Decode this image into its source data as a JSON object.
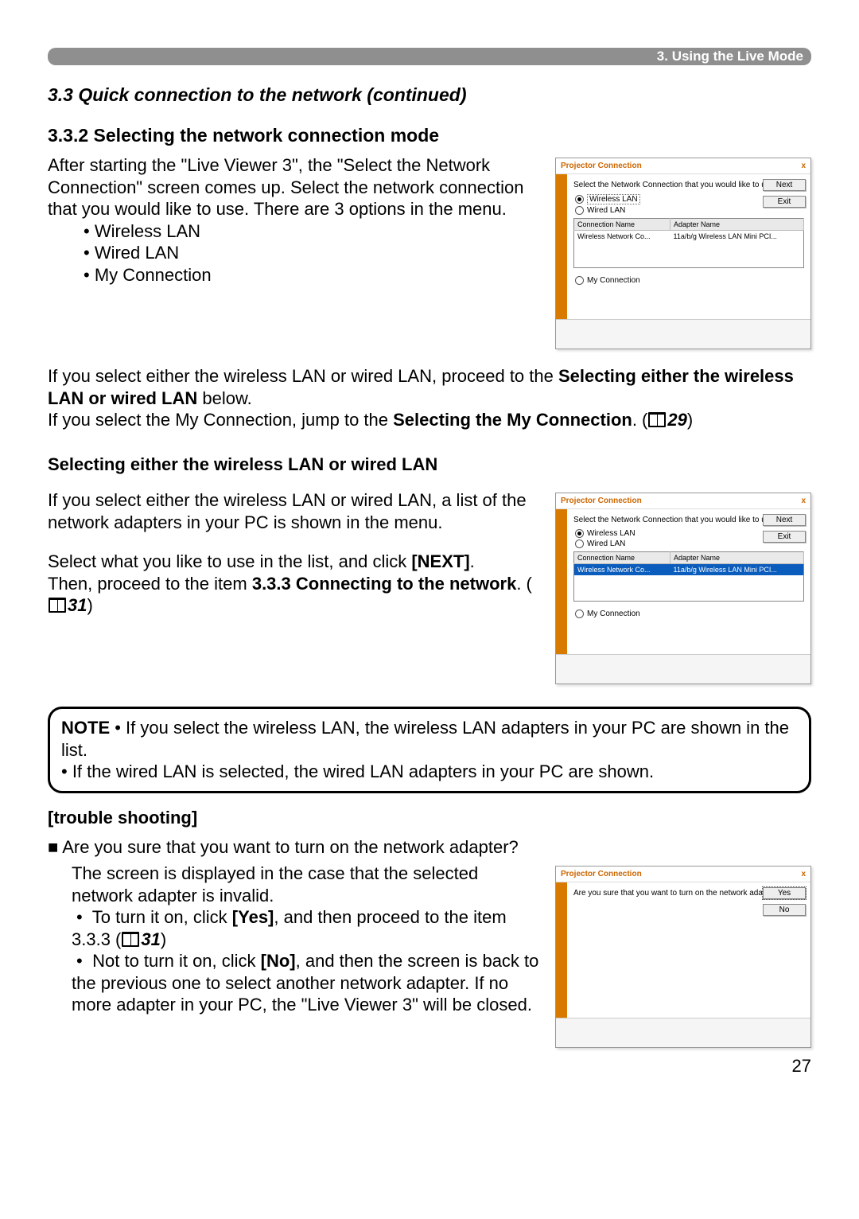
{
  "header": {
    "title": "3. Using the Live Mode"
  },
  "sec_cont": "3.3 Quick connection to the network (continued)",
  "subsec": "3.3.2 Selecting the network connection mode",
  "intro": {
    "p": "After starting the \"Live Viewer 3\", the \"Select the Network Connection\" screen comes up. Select the network connection that you would like to use. There are 3 options in the menu.",
    "options": [
      "Wireless LAN",
      "Wired LAN",
      "My Connection"
    ]
  },
  "follow": {
    "a1": "If you select either the wireless LAN or wired LAN, proceed to the ",
    "a2": "Selecting either the wireless LAN or wired LAN",
    "a3": " below.",
    "b1": "If you select the My Connection, jump to the ",
    "b2": "Selecting the My Connection",
    "b3": ". (",
    "b_ref": "29",
    "b4": ")"
  },
  "sel_head": "Selecting either the wireless LAN or wired LAN",
  "sel_p1": "If you select either the wireless LAN or wired LAN, a list of the network adapters in your PC is shown in the menu.",
  "sel_p2a": "Select what you like to use in the list, and click ",
  "sel_next": "[NEXT]",
  "sel_p2b": ".",
  "sel_p3a": "Then, proceed to the item ",
  "sel_p3b": "3.3.3 Connecting to the network",
  "sel_p3c": ". (",
  "sel_ref": "31",
  "sel_p3d": ")",
  "note": {
    "label": "NOTE",
    "l1": "  • If you select the wireless LAN, the wireless LAN adapters in your PC are shown in the list.",
    "l2": "• If the wired LAN is selected, the wired LAN adapters in your PC are shown."
  },
  "ts_head": "[trouble shooting]",
  "ts_q": "Are you sure that you want to turn on the network adapter?",
  "ts_p": "The screen is displayed in the case that the selected network adapter is invalid.",
  "ts_b1a": "To turn it on, click ",
  "ts_b1b": "[Yes]",
  "ts_b1c": ", and then proceed to the item 3.3.3 (",
  "ts_ref": "31",
  "ts_b1d": ")",
  "ts_b2a": "Not to turn it on, click ",
  "ts_b2b": "[No]",
  "ts_b2c": ", and then the screen is back to the previous one to select another network adapter. If no more adapter in your PC, the \"Live Viewer 3\" will be closed.",
  "page_num": "27",
  "dlg": {
    "title": "Projector Connection",
    "close": "x",
    "instr": "Select the Network Connection that you would like to use.",
    "r_wireless": "Wireless LAN",
    "r_wired": "Wired LAN",
    "r_my": "My Connection",
    "col_conn": "Connection Name",
    "col_adp": "Adapter Name",
    "row_conn": "Wireless Network Co...",
    "row_adp": "11a/b/g Wireless LAN Mini PCI...",
    "btn_next": "Next",
    "btn_exit": "Exit",
    "q_turn_on": "Are you sure that you want to turn on the network adapter?",
    "btn_yes": "Yes",
    "btn_no": "No"
  }
}
